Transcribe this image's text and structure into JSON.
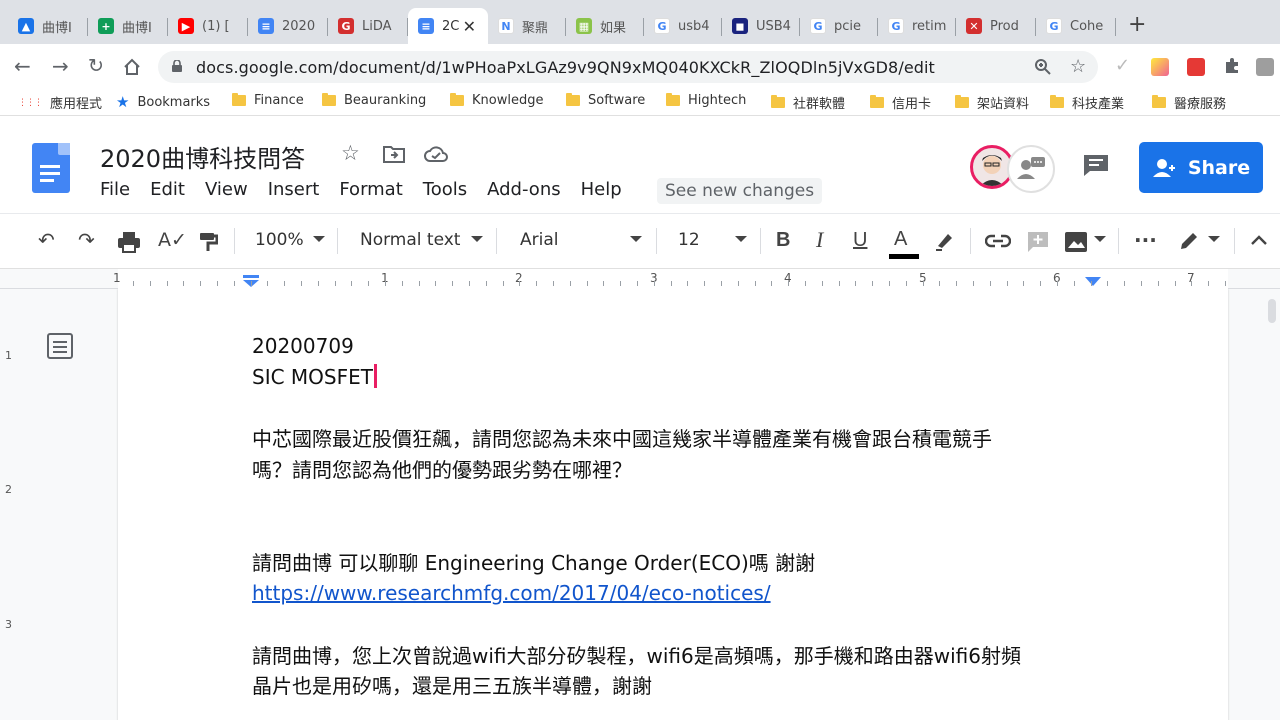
{
  "browser": {
    "tabs": [
      {
        "label": "曲博I",
        "fav_color": "#1a73e8",
        "fav_glyph": "▲",
        "icon": "google-drive-icon"
      },
      {
        "label": "曲博I",
        "fav_color": "#0f9d58",
        "fav_glyph": "+",
        "icon": "google-sheets-icon"
      },
      {
        "label": "(1) [",
        "fav_color": "#ff0000",
        "fav_glyph": "▶",
        "icon": "youtube-icon"
      },
      {
        "label": "2020",
        "fav_color": "#4285f4",
        "fav_glyph": "≡",
        "icon": "google-docs-icon"
      },
      {
        "label": "LiDA",
        "fav_color": "#d32f2f",
        "fav_glyph": "G",
        "icon": "red-g-icon"
      },
      {
        "label": "2C",
        "fav_color": "#4285f4",
        "fav_glyph": "≡",
        "icon": "google-docs-icon",
        "active": true
      },
      {
        "label": "聚鼎",
        "fav_color": "#ffffff",
        "fav_glyph": "N",
        "icon": "n-logo-icon"
      },
      {
        "label": "如果",
        "fav_color": "#8bc34a",
        "fav_glyph": "▦",
        "icon": "grid-site-icon"
      },
      {
        "label": "usb4",
        "fav_color": "#ffffff",
        "fav_glyph": "G",
        "icon": "google-icon"
      },
      {
        "label": "USB4",
        "fav_color": "#1a237e",
        "fav_glyph": "◼",
        "icon": "crl-icon"
      },
      {
        "label": "pcie",
        "fav_color": "#ffffff",
        "fav_glyph": "G",
        "icon": "google-icon"
      },
      {
        "label": "retim",
        "fav_color": "#ffffff",
        "fav_glyph": "G",
        "icon": "google-icon"
      },
      {
        "label": "Prod",
        "fav_color": "#d32f2f",
        "fav_glyph": "✕",
        "icon": "product-icon"
      },
      {
        "label": "Cohe",
        "fav_color": "#ffffff",
        "fav_glyph": "G",
        "icon": "google-icon"
      }
    ],
    "url": "docs.google.com/document/d/1wPHoaPxLGAz9v9QN9xMQ040KXCkR_ZlOQDln5jVxGD8/edit",
    "bookmarks": [
      {
        "label": "應用程式",
        "type": "apps"
      },
      {
        "label": "Bookmarks",
        "type": "star"
      },
      {
        "label": "Finance",
        "type": "folder"
      },
      {
        "label": "Beauranking",
        "type": "folder"
      },
      {
        "label": "Knowledge",
        "type": "folder"
      },
      {
        "label": "Software",
        "type": "folder"
      },
      {
        "label": "Hightech",
        "type": "folder"
      },
      {
        "label": "社群軟體",
        "type": "folder"
      },
      {
        "label": "信用卡",
        "type": "folder"
      },
      {
        "label": "架站資料",
        "type": "folder"
      },
      {
        "label": "科技產業",
        "type": "folder"
      },
      {
        "label": "醫療服務",
        "type": "folder"
      }
    ]
  },
  "docs": {
    "title": "2020曲博科技問答",
    "menu": [
      "File",
      "Edit",
      "View",
      "Insert",
      "Format",
      "Tools",
      "Add-ons",
      "Help"
    ],
    "see_new_changes": "See new changes",
    "share_label": "Share",
    "toolbar": {
      "zoom": "100%",
      "style": "Normal text",
      "font": "Arial",
      "font_size": "12"
    },
    "ruler_numbers": [
      "1",
      "1",
      "2",
      "3",
      "4",
      "5",
      "6",
      "7"
    ],
    "vruler_numbers": [
      "1",
      "2",
      "3"
    ]
  },
  "document": {
    "line1": "20200709",
    "line2": "SIC MOSFET",
    "q1_line1": "中芯國際最近股價狂飆，請問您認為未來中國這幾家半導體產業有機會跟台積電競手",
    "q1_line2": "嗎？請問您認為他們的優勢跟劣勢在哪裡？",
    "q2_line1": "請問曲博 可以聊聊 Engineering Change Order(ECO)嗎 謝謝",
    "q2_link": "https://www.researchmfg.com/2017/04/eco-notices/",
    "q3_line1": "請問曲博，您上次曾說過wifi大部分矽製程，wifi6是高頻嗎，那手機和路由器wifi6射頻",
    "q3_line2": "晶片也是用矽嗎，還是用三五族半導體，謝謝"
  },
  "colors": {
    "share_blue": "#1a73e8",
    "link_blue": "#1155cc",
    "cursor_pink": "#e91e63",
    "ruler_marker": "#4285f4"
  }
}
